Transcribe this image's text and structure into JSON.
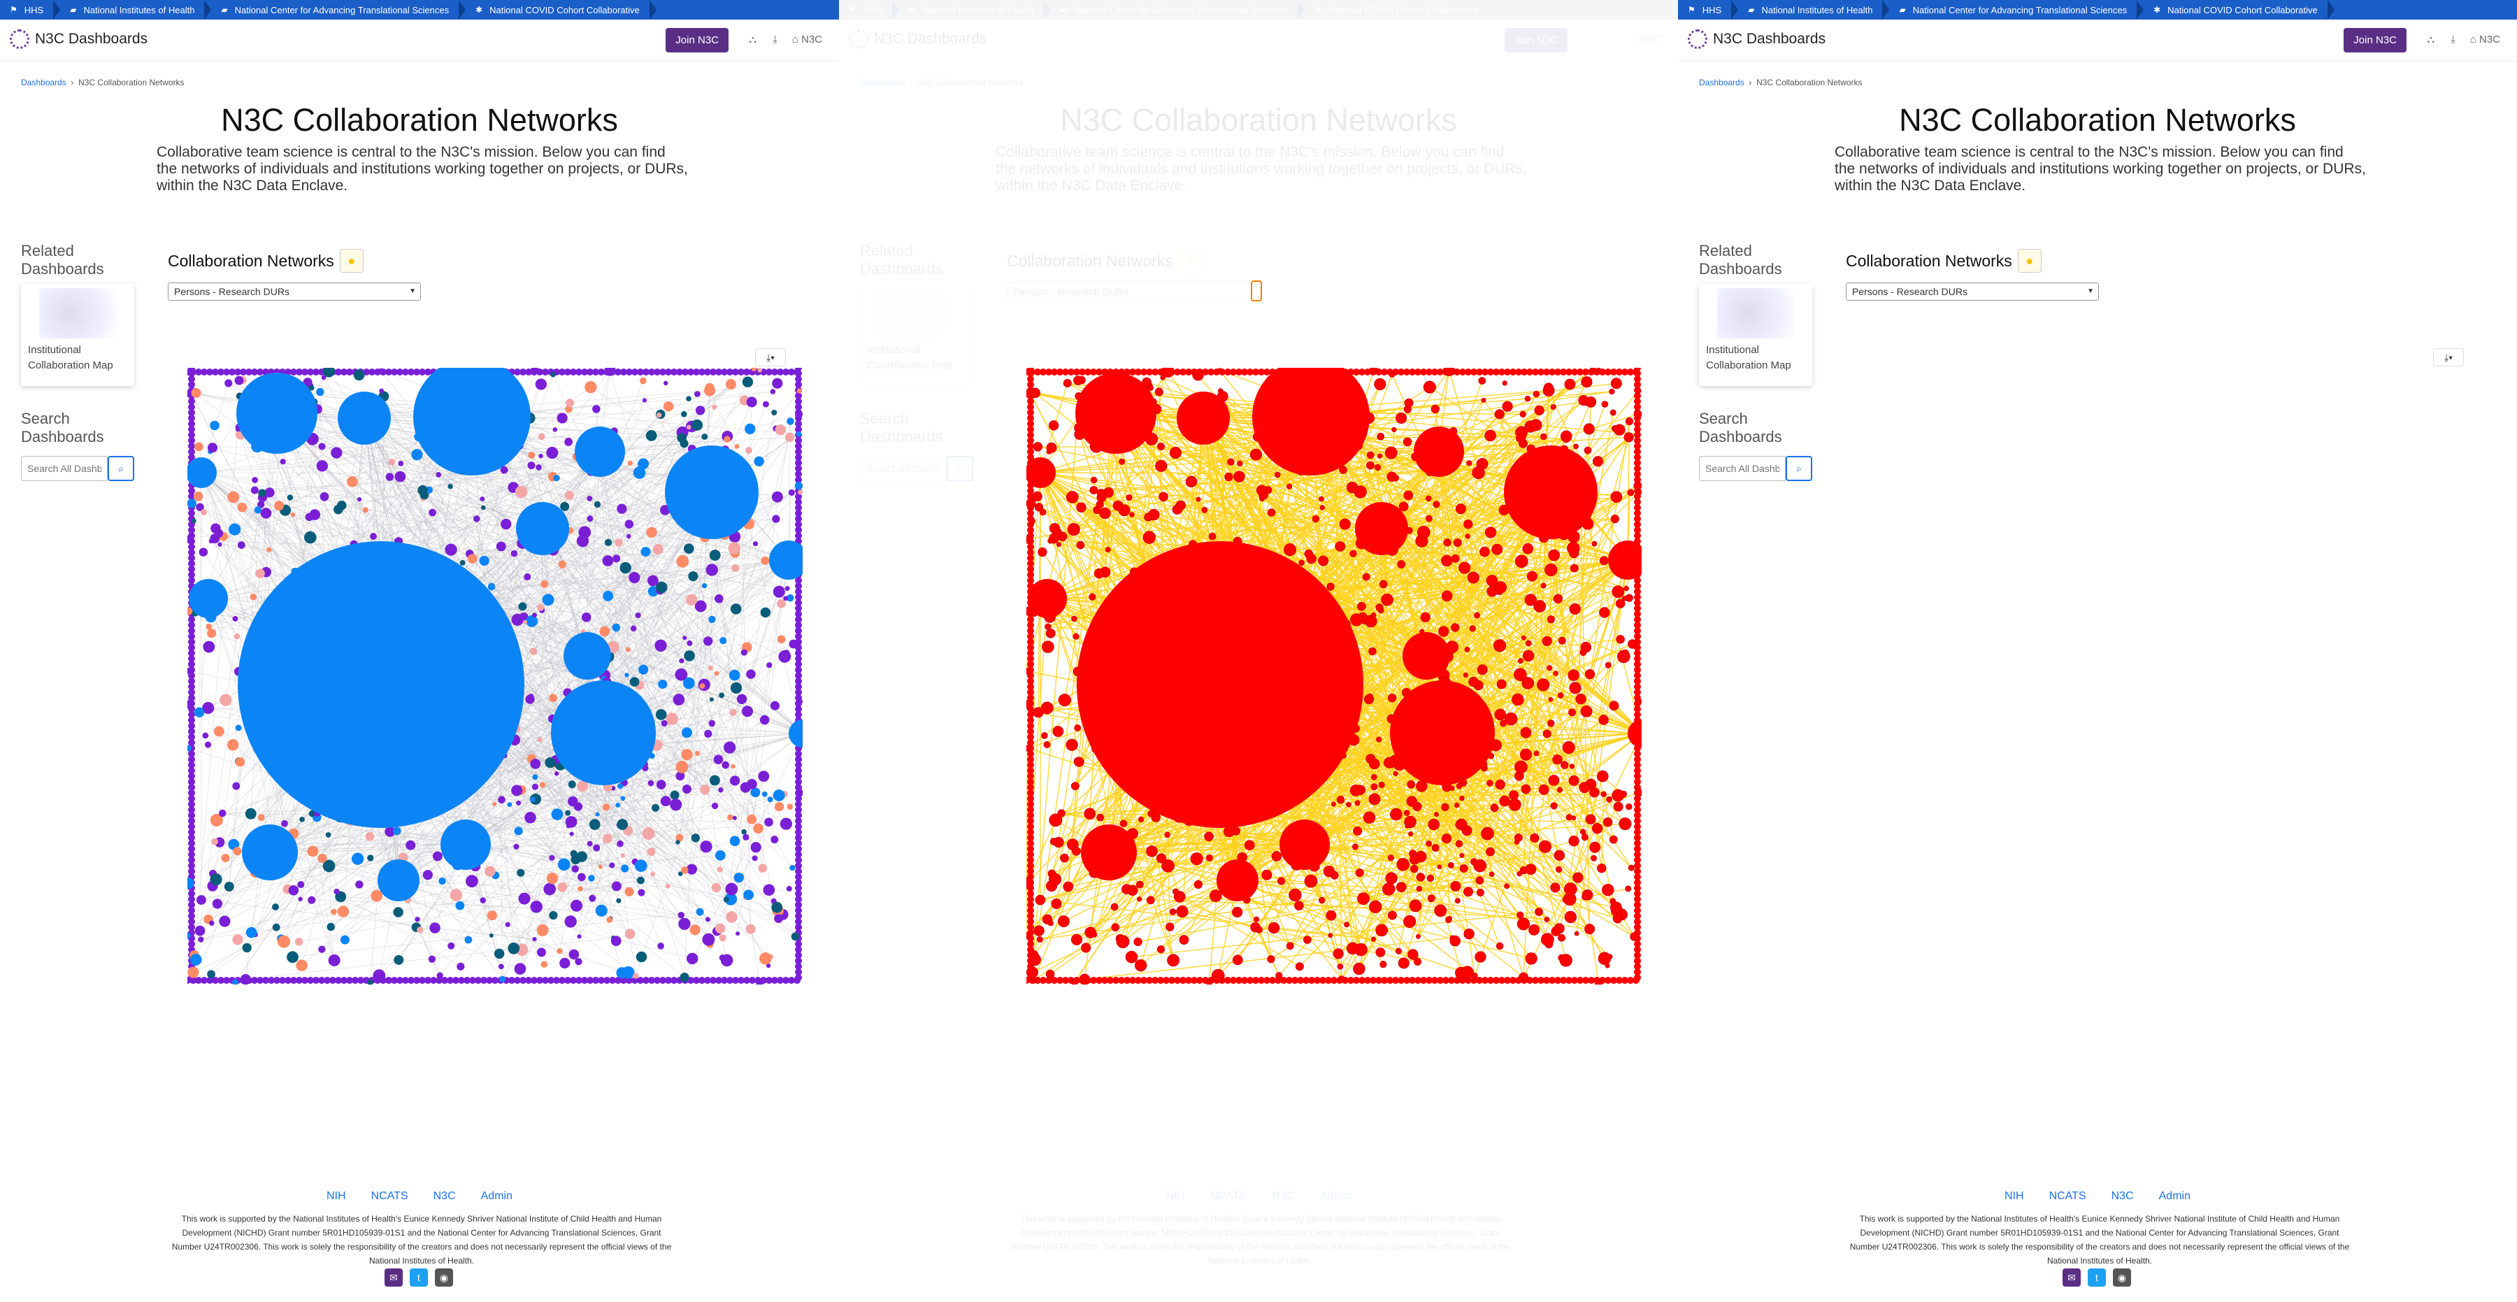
{
  "topbar": {
    "items": [
      {
        "icon": "hhs-eagle-icon",
        "label": "HHS"
      },
      {
        "icon": "nih-flag-icon",
        "label": "National Institutes of Health"
      },
      {
        "icon": "ncats-flag-icon",
        "label": "National Center for Advancing Translational Sciences"
      },
      {
        "icon": "n3c-logo-icon",
        "label": "National COVID Cohort Collaborative"
      }
    ]
  },
  "header": {
    "logo_text": "N3C Dashboards",
    "join_label": "Join N3C",
    "n3c_label": "N3C",
    "icons": [
      "network-icon",
      "download-icon",
      "home-icon"
    ]
  },
  "breadcrumb": {
    "root": "Dashboards",
    "current": "N3C Collaboration Networks"
  },
  "page_title": "N3C Collaboration Networks",
  "intro": "Collaborative team science is central to the N3C's mission. Below you can find the networks of individuals and institutions working together on projects, or DURs, within the N3C Data Enclave.",
  "sidebar": {
    "related_heading": "Related Dashboards",
    "related_card_label": "Institutional Collaboration Map",
    "search_heading": "Search Dashboards",
    "search_placeholder": "Search All Dashboards"
  },
  "network": {
    "title": "Collaboration Networks",
    "select_value": "Persons - Research DURs",
    "download_label": "▼"
  },
  "colors": {
    "topbar": "#1a5ec8",
    "join": "#5b2e86",
    "node_blue": "#0b84f5",
    "node_purple": "#7a1fd6",
    "node_orange": "#ff8a65",
    "node_red": "#ff0000",
    "edge_highlight": "#ffd21f"
  },
  "footer": {
    "links": [
      "NIH",
      "NCATS",
      "N3C",
      "Admin"
    ],
    "note": "This work is supported by the National Institutes of Health's Eunice Kennedy Shriver National Institute of Child Health and Human Development (NICHD) Grant number 5R01HD105939-01S1 and the National Center for Advancing Translational Sciences, Grant Number U24TR002306. This work is solely the responsibility of the creators and does not necessarily represent the official views of the National Institutes of Health.",
    "socials": [
      "email-icon",
      "twitter-icon",
      "github-icon"
    ]
  }
}
